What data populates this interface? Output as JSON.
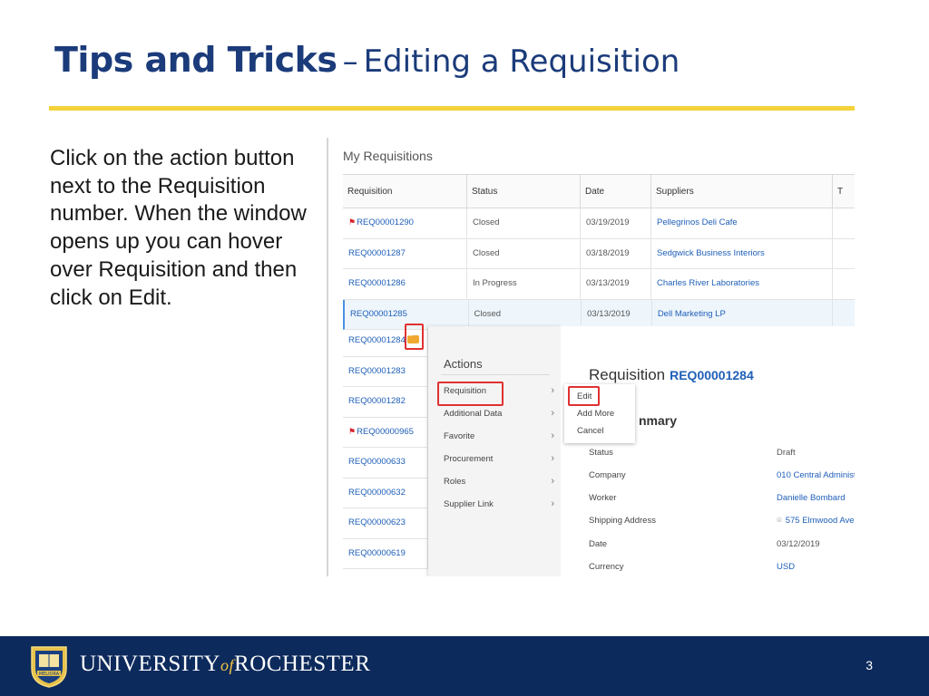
{
  "slide": {
    "title_bold": "Tips and Tricks",
    "title_dash": "–",
    "title_normal": "Editing a Requisition",
    "instructions": "Click on the action button next to the Requisition number. When the window opens up you can hover over Requisition and then click on Edit.",
    "page_number": "3"
  },
  "screenshot": {
    "heading": "My Requisitions",
    "columns": [
      "Requisition",
      "Status",
      "Date",
      "Suppliers",
      "T"
    ],
    "rows": [
      {
        "req": "REQ00001290",
        "status": "Closed",
        "date": "03/19/2019",
        "supplier": "Pellegrinos Deli Cafe",
        "flag": true
      },
      {
        "req": "REQ00001287",
        "status": "Closed",
        "date": "03/18/2019",
        "supplier": "Sedgwick Business Interiors",
        "flag": false
      },
      {
        "req": "REQ00001286",
        "status": "In Progress",
        "date": "03/13/2019",
        "supplier": "Charles River Laboratories",
        "flag": false
      },
      {
        "req": "REQ00001285",
        "status": "Closed",
        "date": "03/13/2019",
        "supplier": "Dell Marketing LP",
        "flag": false,
        "selected": true
      }
    ],
    "short_rows": [
      {
        "req": "REQ00001284",
        "action_button": true
      },
      {
        "req": "REQ00001283"
      },
      {
        "req": "REQ00001282"
      },
      {
        "req": "REQ00000965",
        "flag": true
      },
      {
        "req": "REQ00000633"
      },
      {
        "req": "REQ00000632"
      },
      {
        "req": "REQ00000623"
      },
      {
        "req": "REQ00000619"
      }
    ],
    "actions_menu": {
      "title": "Actions",
      "items": [
        "Requisition",
        "Additional Data",
        "Favorite",
        "Procurement",
        "Roles",
        "Supplier Link"
      ]
    },
    "submenu": {
      "items": [
        "Edit",
        "Add More",
        "Cancel"
      ]
    },
    "detail": {
      "title": "Requisition",
      "number": "REQ00001284",
      "summary_partial": "nmary",
      "fields": [
        {
          "label": "Status",
          "value": "Draft",
          "link": false
        },
        {
          "label": "Company",
          "value": "010 Central Administ",
          "link": true
        },
        {
          "label": "Worker",
          "value": "Danielle Bombard",
          "link": true
        },
        {
          "label": "Shipping Address",
          "value": "575 Elmwood Ave",
          "link": true,
          "pin": true
        },
        {
          "label": "Date",
          "value": "03/12/2019",
          "link": false
        },
        {
          "label": "Currency",
          "value": "USD",
          "link": true
        }
      ]
    }
  },
  "footer": {
    "university_1": "UNIVERSITY",
    "university_of": "of",
    "university_2": "ROCHESTER",
    "seal_text": "MELIORA"
  },
  "colors": {
    "title": "#1b3b7a",
    "accent_rule": "#f5d23a",
    "footer_bg": "#0d2a5c",
    "link": "#1f5fb8",
    "highlight": "#e03131",
    "action_button": "#f0a830"
  }
}
